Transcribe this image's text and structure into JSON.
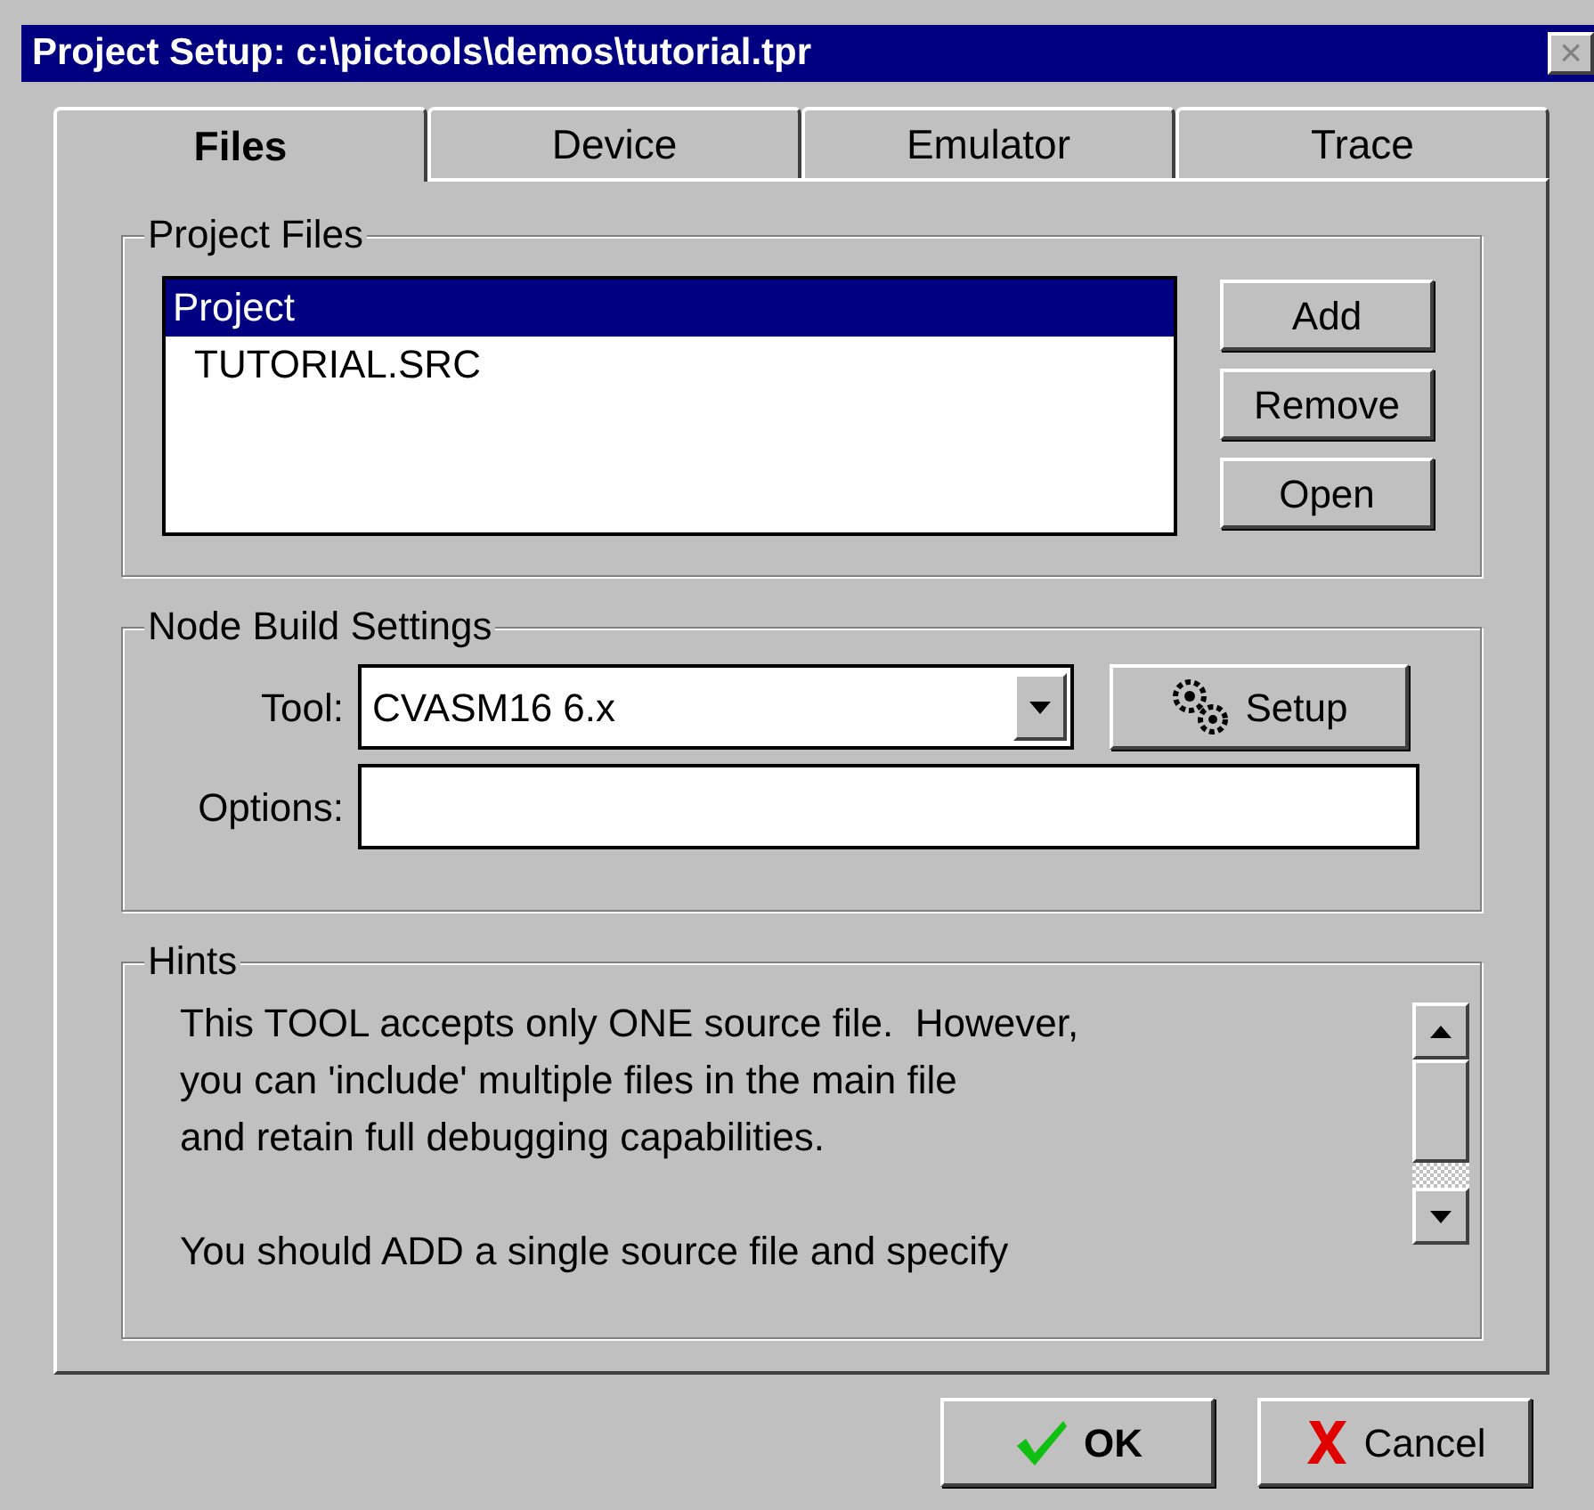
{
  "window": {
    "title": "Project Setup: c:\\pictools\\demos\\tutorial.tpr",
    "close": "×"
  },
  "tabs": [
    {
      "label": "Files",
      "selected": true
    },
    {
      "label": "Device",
      "selected": false
    },
    {
      "label": "Emulator",
      "selected": false
    },
    {
      "label": "Trace",
      "selected": false
    }
  ],
  "project_files": {
    "title": "Project Files",
    "items": [
      {
        "label": "Project",
        "selected": true
      },
      {
        "label": "TUTORIAL.SRC",
        "selected": false
      }
    ],
    "buttons": [
      "Add",
      "Remove",
      "Open"
    ]
  },
  "node_build_settings": {
    "title": "Node Build Settings",
    "tool_label": "Tool:",
    "tool_value": "CVASM16 6.x",
    "setup_button": "Setup",
    "options_label": "Options:"
  },
  "hints": {
    "title": "Hints",
    "paragraphs": [
      [
        "This TOOL accepts only ONE source file.  However,",
        "you can 'include' multiple files in the main file",
        "and retain full debugging capabilities."
      ],
      [
        "You should ADD a single source file and specify"
      ]
    ]
  },
  "buttons": [
    {
      "kind": "ok",
      "label": "OK"
    },
    {
      "kind": "cancel",
      "label": "Cancel"
    }
  ]
}
